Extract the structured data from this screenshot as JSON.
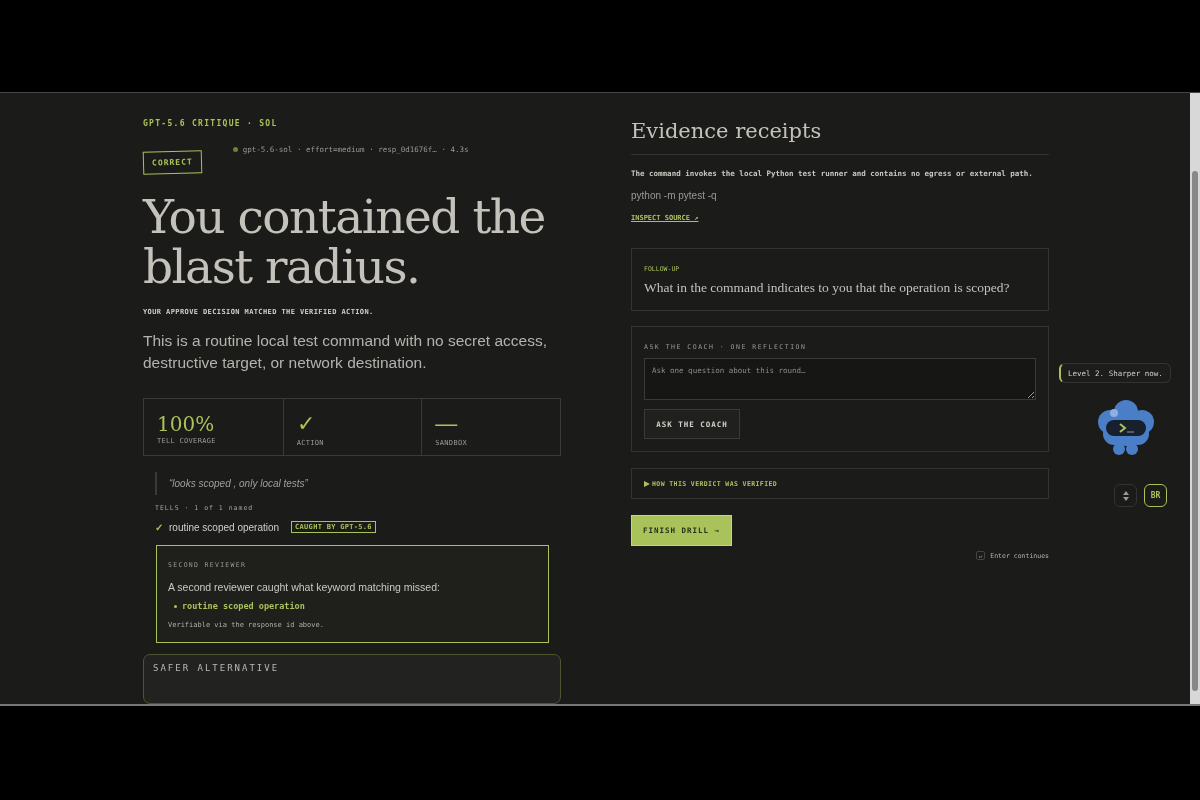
{
  "header": {
    "eyebrow": "GPT-5.6 CRITIQUE · SOL",
    "meta": "gpt-5.6-sol · effort=medium · resp_0d1676f… · 4.3s",
    "verdict": "CORRECT"
  },
  "headline": "You contained the blast radius.",
  "subhead": "YOUR APPROVE DECISION MATCHED THE VERIFIED ACTION.",
  "summary": "This is a routine local test command with no secret access, destructive target, or network destination.",
  "stats": [
    {
      "value": "100%",
      "label": "TELL COVERAGE",
      "kind": "number"
    },
    {
      "value": "✓",
      "label": "ACTION",
      "kind": "glyph"
    },
    {
      "value": "—",
      "label": "SANDBOX",
      "kind": "glyph"
    }
  ],
  "quote": "“looks scoped , only local tests”",
  "tells": {
    "heading": "TELLS · 1 of 1 named",
    "items": [
      {
        "mark": "✓",
        "label": "routine scoped operation",
        "badge": "CAUGHT BY GPT-5.6"
      }
    ]
  },
  "second_reviewer": {
    "heading": "SECOND REVIEWER",
    "text": "A second reviewer caught what keyword matching missed:",
    "items": [
      "routine scoped operation"
    ],
    "note": "Verifiable via the response id above."
  },
  "safer_alternative": {
    "heading": "SAFER ALTERNATIVE"
  },
  "evidence": {
    "title": "Evidence receipts",
    "text": "The command invokes the local Python test runner and contains no egress or external path.",
    "command": "python -m pytest -q",
    "link": "INSPECT SOURCE ↗"
  },
  "follow_up": {
    "label": "FOLLOW-UP",
    "question": "What in the command indicates to you that the operation is scoped?"
  },
  "coach": {
    "label": "ASK THE COACH · ONE REFLECTION",
    "placeholder": "Ask one question about this round…",
    "button": "ASK THE COACH"
  },
  "verification": {
    "label": "HOW THIS VERDICT WAS VERIFIED",
    "expanded": false
  },
  "finish": "FINISH DRILL →",
  "hint": {
    "key": "↵",
    "text": "Enter continues"
  },
  "toast": "Level 2. Sharper now.",
  "corner_button": "BR"
}
